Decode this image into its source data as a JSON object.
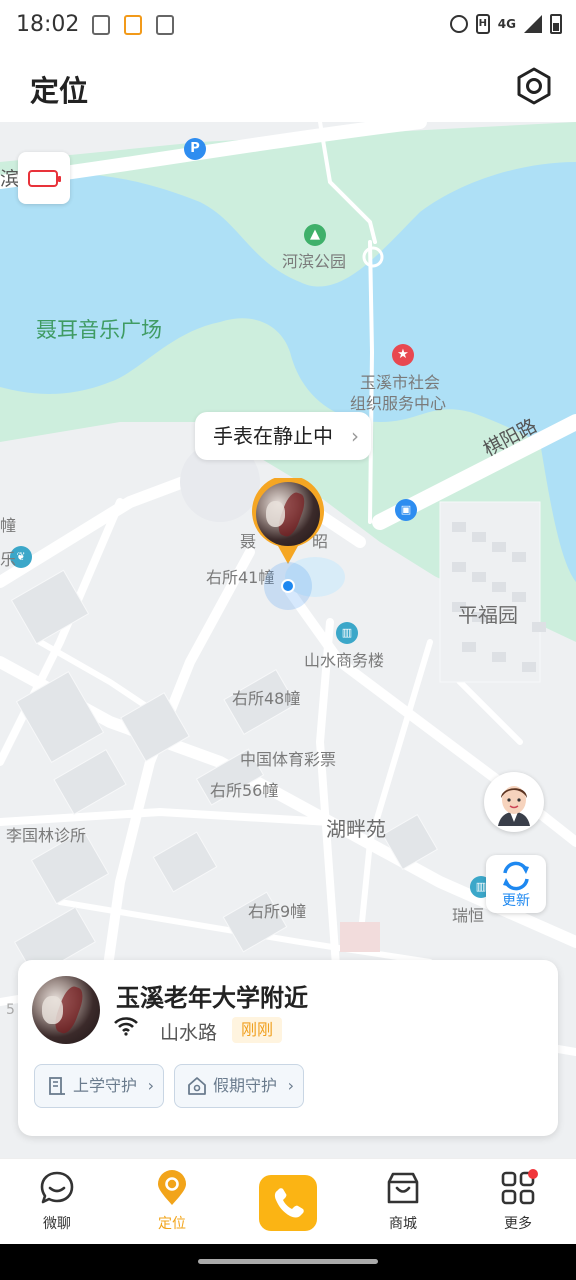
{
  "status_bar": {
    "time": "18:02",
    "network": "4G",
    "icons": [
      "alarm-icon",
      "hd-icon",
      "signal-icon",
      "battery-icon"
    ],
    "notifications": [
      "app-notification-icon",
      "app-notification-icon",
      "app-notification-icon"
    ]
  },
  "header": {
    "title": "定位",
    "settings_icon": "gear-icon"
  },
  "map": {
    "labels": {
      "park": "河滨公园",
      "square": "聂耳音乐广场",
      "center_line1": "玉溪市社会",
      "center_line2": "组织服务中心",
      "road_qiyang": "棋阳路",
      "building_41": "右所41幢",
      "business": "山水商务楼",
      "pingfu": "平福园",
      "building_48": "右所48幢",
      "lottery": "中国体育彩票",
      "building_56": "右所56幢",
      "clinic": "李国林诊所",
      "hupan": "湖畔苑",
      "building_9": "右所9幢",
      "ruiheng": "瑞恒",
      "edge_bin": "滨",
      "edge_zhuang": "幢",
      "edge_shui": "山水",
      "edge_yue": "乐",
      "edge_num": "5",
      "under_marker_left": "聂",
      "under_marker_right": "昭"
    },
    "battery_level": "low",
    "watch_status": "手表在静止中",
    "refresh_label": "更新",
    "colors": {
      "water": "#aee0f6",
      "green": "#cdeedd",
      "roads": "#ffffff",
      "land": "#eef0f2"
    }
  },
  "card": {
    "location": "玉溪老年大学附近",
    "road": "山水路",
    "time_tag": "刚刚",
    "guard_school": "上学守护",
    "guard_holiday": "假期守护"
  },
  "nav": {
    "chat": "微聊",
    "locate": "定位",
    "call_icon": "phone-icon",
    "shop": "商城",
    "more": "更多",
    "active": "定位",
    "accent": "#f2a41a"
  }
}
